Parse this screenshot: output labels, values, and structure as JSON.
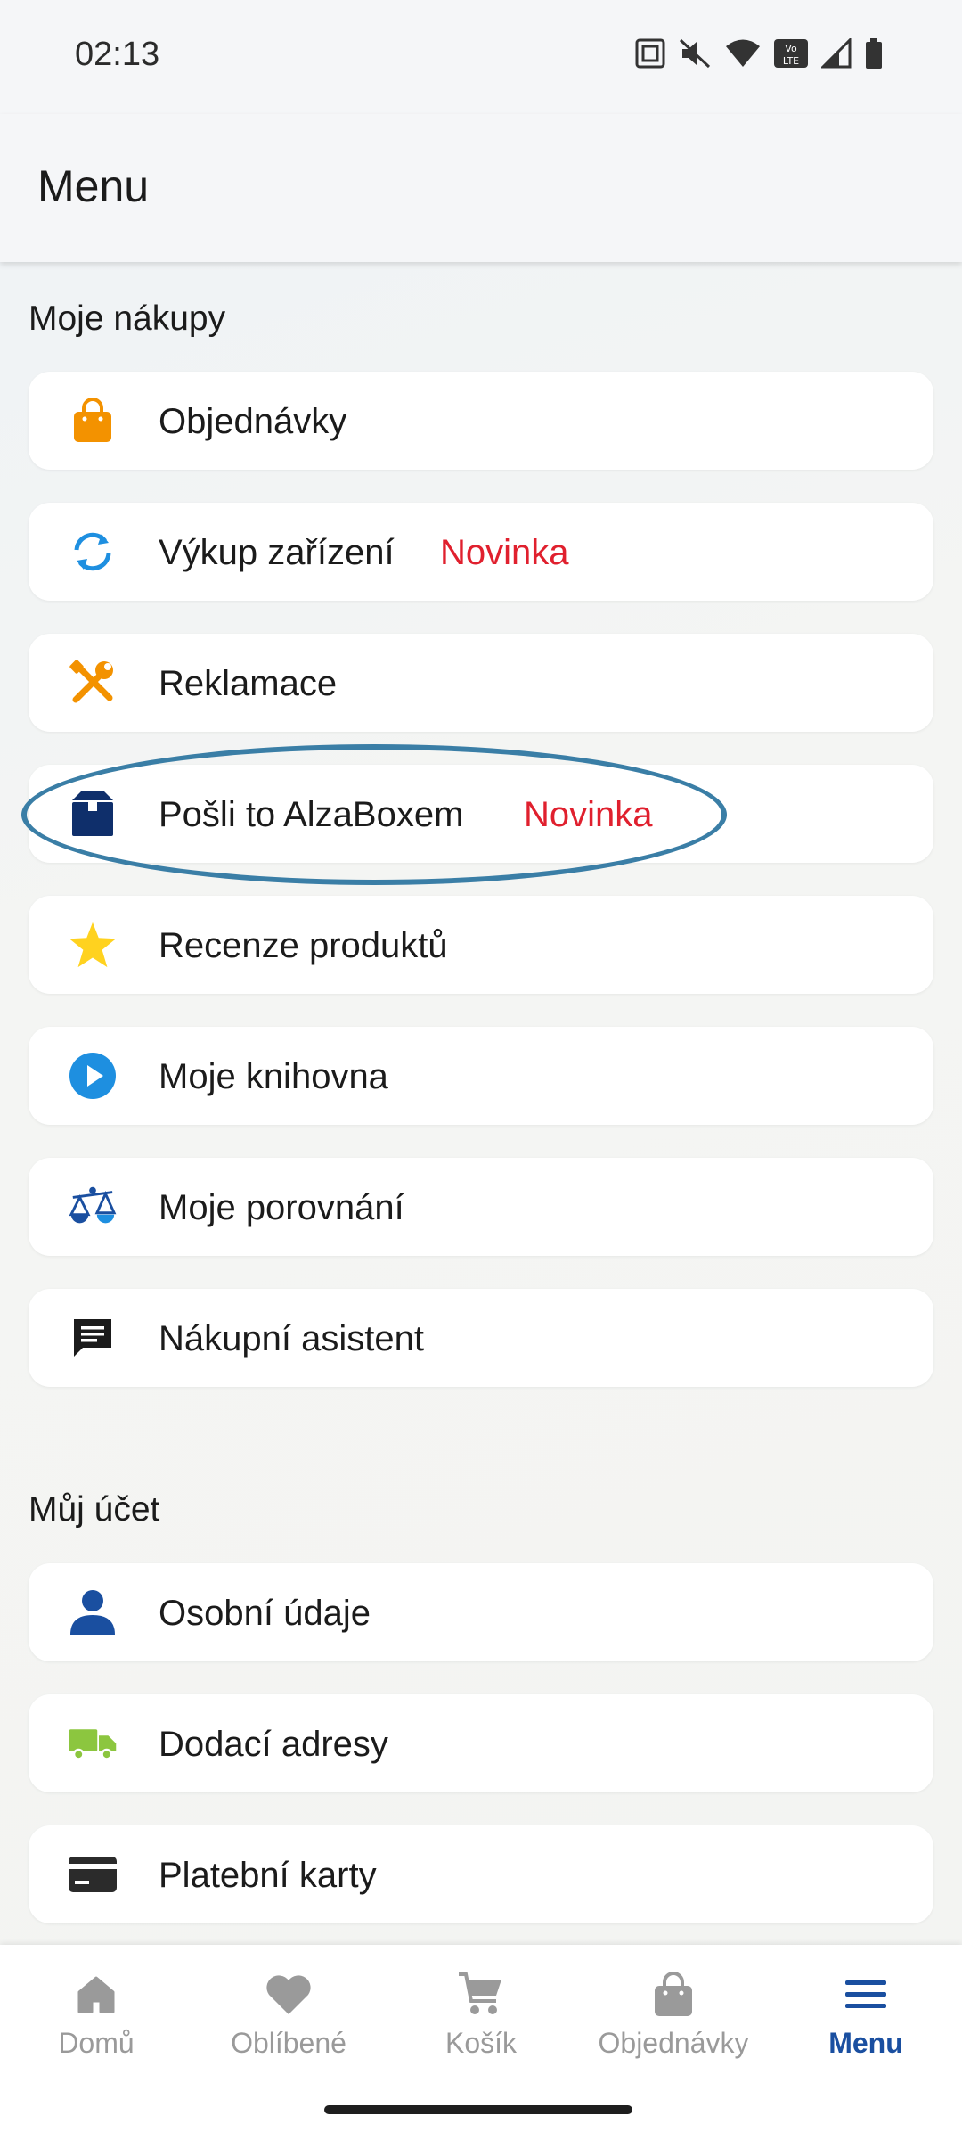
{
  "status": {
    "time": "02:13",
    "icons": [
      "nfc-icon",
      "mute-icon",
      "wifi-icon",
      "volte-icon",
      "signal-icon",
      "battery-icon"
    ]
  },
  "header": {
    "title": "Menu"
  },
  "sections": {
    "purchases": {
      "title": "Moje nákupy",
      "items": [
        {
          "label": "Objednávky",
          "icon": "shopping-bag-icon",
          "badge": ""
        },
        {
          "label": "Výkup zařízení",
          "icon": "exchange-icon",
          "badge": "Novinka"
        },
        {
          "label": "Reklamace",
          "icon": "tools-icon",
          "badge": ""
        },
        {
          "label": "Pošli to AlzaBoxem",
          "icon": "box-icon",
          "badge": "Novinka"
        },
        {
          "label": "Recenze produktů",
          "icon": "star-icon",
          "badge": ""
        },
        {
          "label": "Moje knihovna",
          "icon": "play-icon",
          "badge": ""
        },
        {
          "label": "Moje porovnání",
          "icon": "scales-icon",
          "badge": ""
        },
        {
          "label": "Nákupní asistent",
          "icon": "chat-icon",
          "badge": ""
        }
      ]
    },
    "account": {
      "title": "Můj účet",
      "items": [
        {
          "label": "Osobní údaje",
          "icon": "person-icon"
        },
        {
          "label": "Dodací adresy",
          "icon": "truck-icon"
        },
        {
          "label": "Platební karty",
          "icon": "credit-card-icon"
        }
      ]
    }
  },
  "bottom_nav": {
    "items": [
      {
        "label": "Domů",
        "icon": "home-icon",
        "active": false
      },
      {
        "label": "Oblíbené",
        "icon": "heart-icon",
        "active": false
      },
      {
        "label": "Košík",
        "icon": "cart-icon",
        "active": false
      },
      {
        "label": "Objednávky",
        "icon": "bag-icon",
        "active": false
      },
      {
        "label": "Menu",
        "icon": "menu-icon",
        "active": true
      }
    ]
  },
  "colors": {
    "badge": "#e0202e",
    "accent": "#1a4fa0",
    "highlight": "#3a7ea6",
    "orange": "#f39200",
    "green": "#8cc63f"
  }
}
